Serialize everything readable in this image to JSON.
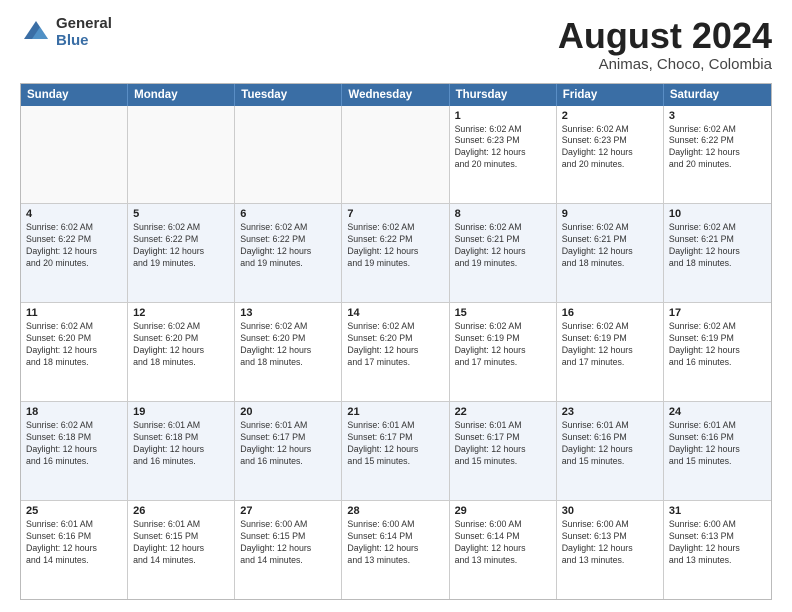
{
  "logo": {
    "general": "General",
    "blue": "Blue"
  },
  "title": "August 2024",
  "subtitle": "Animas, Choco, Colombia",
  "weekdays": [
    "Sunday",
    "Monday",
    "Tuesday",
    "Wednesday",
    "Thursday",
    "Friday",
    "Saturday"
  ],
  "rows": [
    [
      {
        "day": "",
        "text": "",
        "empty": true
      },
      {
        "day": "",
        "text": "",
        "empty": true
      },
      {
        "day": "",
        "text": "",
        "empty": true
      },
      {
        "day": "",
        "text": "",
        "empty": true
      },
      {
        "day": "1",
        "text": "Sunrise: 6:02 AM\nSunset: 6:23 PM\nDaylight: 12 hours\nand 20 minutes."
      },
      {
        "day": "2",
        "text": "Sunrise: 6:02 AM\nSunset: 6:23 PM\nDaylight: 12 hours\nand 20 minutes."
      },
      {
        "day": "3",
        "text": "Sunrise: 6:02 AM\nSunset: 6:22 PM\nDaylight: 12 hours\nand 20 minutes."
      }
    ],
    [
      {
        "day": "4",
        "text": "Sunrise: 6:02 AM\nSunset: 6:22 PM\nDaylight: 12 hours\nand 20 minutes."
      },
      {
        "day": "5",
        "text": "Sunrise: 6:02 AM\nSunset: 6:22 PM\nDaylight: 12 hours\nand 19 minutes."
      },
      {
        "day": "6",
        "text": "Sunrise: 6:02 AM\nSunset: 6:22 PM\nDaylight: 12 hours\nand 19 minutes."
      },
      {
        "day": "7",
        "text": "Sunrise: 6:02 AM\nSunset: 6:22 PM\nDaylight: 12 hours\nand 19 minutes."
      },
      {
        "day": "8",
        "text": "Sunrise: 6:02 AM\nSunset: 6:21 PM\nDaylight: 12 hours\nand 19 minutes."
      },
      {
        "day": "9",
        "text": "Sunrise: 6:02 AM\nSunset: 6:21 PM\nDaylight: 12 hours\nand 18 minutes."
      },
      {
        "day": "10",
        "text": "Sunrise: 6:02 AM\nSunset: 6:21 PM\nDaylight: 12 hours\nand 18 minutes."
      }
    ],
    [
      {
        "day": "11",
        "text": "Sunrise: 6:02 AM\nSunset: 6:20 PM\nDaylight: 12 hours\nand 18 minutes."
      },
      {
        "day": "12",
        "text": "Sunrise: 6:02 AM\nSunset: 6:20 PM\nDaylight: 12 hours\nand 18 minutes."
      },
      {
        "day": "13",
        "text": "Sunrise: 6:02 AM\nSunset: 6:20 PM\nDaylight: 12 hours\nand 18 minutes."
      },
      {
        "day": "14",
        "text": "Sunrise: 6:02 AM\nSunset: 6:20 PM\nDaylight: 12 hours\nand 17 minutes."
      },
      {
        "day": "15",
        "text": "Sunrise: 6:02 AM\nSunset: 6:19 PM\nDaylight: 12 hours\nand 17 minutes."
      },
      {
        "day": "16",
        "text": "Sunrise: 6:02 AM\nSunset: 6:19 PM\nDaylight: 12 hours\nand 17 minutes."
      },
      {
        "day": "17",
        "text": "Sunrise: 6:02 AM\nSunset: 6:19 PM\nDaylight: 12 hours\nand 16 minutes."
      }
    ],
    [
      {
        "day": "18",
        "text": "Sunrise: 6:02 AM\nSunset: 6:18 PM\nDaylight: 12 hours\nand 16 minutes."
      },
      {
        "day": "19",
        "text": "Sunrise: 6:01 AM\nSunset: 6:18 PM\nDaylight: 12 hours\nand 16 minutes."
      },
      {
        "day": "20",
        "text": "Sunrise: 6:01 AM\nSunset: 6:17 PM\nDaylight: 12 hours\nand 16 minutes."
      },
      {
        "day": "21",
        "text": "Sunrise: 6:01 AM\nSunset: 6:17 PM\nDaylight: 12 hours\nand 15 minutes."
      },
      {
        "day": "22",
        "text": "Sunrise: 6:01 AM\nSunset: 6:17 PM\nDaylight: 12 hours\nand 15 minutes."
      },
      {
        "day": "23",
        "text": "Sunrise: 6:01 AM\nSunset: 6:16 PM\nDaylight: 12 hours\nand 15 minutes."
      },
      {
        "day": "24",
        "text": "Sunrise: 6:01 AM\nSunset: 6:16 PM\nDaylight: 12 hours\nand 15 minutes."
      }
    ],
    [
      {
        "day": "25",
        "text": "Sunrise: 6:01 AM\nSunset: 6:16 PM\nDaylight: 12 hours\nand 14 minutes."
      },
      {
        "day": "26",
        "text": "Sunrise: 6:01 AM\nSunset: 6:15 PM\nDaylight: 12 hours\nand 14 minutes."
      },
      {
        "day": "27",
        "text": "Sunrise: 6:00 AM\nSunset: 6:15 PM\nDaylight: 12 hours\nand 14 minutes."
      },
      {
        "day": "28",
        "text": "Sunrise: 6:00 AM\nSunset: 6:14 PM\nDaylight: 12 hours\nand 13 minutes."
      },
      {
        "day": "29",
        "text": "Sunrise: 6:00 AM\nSunset: 6:14 PM\nDaylight: 12 hours\nand 13 minutes."
      },
      {
        "day": "30",
        "text": "Sunrise: 6:00 AM\nSunset: 6:13 PM\nDaylight: 12 hours\nand 13 minutes."
      },
      {
        "day": "31",
        "text": "Sunrise: 6:00 AM\nSunset: 6:13 PM\nDaylight: 12 hours\nand 13 minutes."
      }
    ]
  ],
  "altRows": [
    1,
    3
  ]
}
